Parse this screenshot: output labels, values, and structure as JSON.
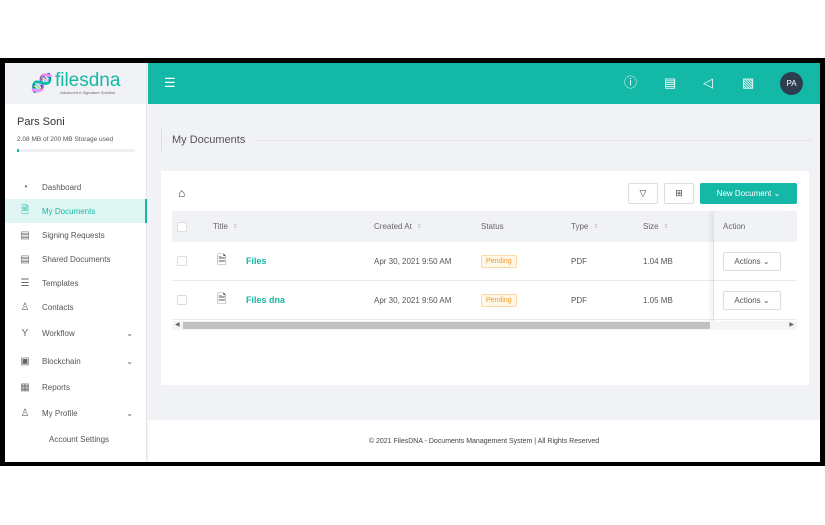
{
  "brand": {
    "name": "filesdna",
    "tagline": "Advanced e-Signature Solution"
  },
  "user": {
    "name": "Pars Soni",
    "storage": "2.08 MB of 200 MB Storage used",
    "storage_used_pct": 1.04,
    "avatar_initials": "PA"
  },
  "sidebar": {
    "items": [
      {
        "label": "Dashboard",
        "icon": "dashboard-icon"
      },
      {
        "label": "My Documents",
        "icon": "document-icon",
        "active": true
      },
      {
        "label": "Signing Requests",
        "icon": "signing-icon"
      },
      {
        "label": "Shared Documents",
        "icon": "shared-icon"
      },
      {
        "label": "Templates",
        "icon": "template-icon"
      },
      {
        "label": "Contacts",
        "icon": "contacts-icon"
      },
      {
        "label": "Workflow",
        "icon": "workflow-icon",
        "expandable": true
      },
      {
        "label": "Blockchain",
        "icon": "blockchain-icon",
        "expandable": true
      },
      {
        "label": "Reports",
        "icon": "reports-icon"
      },
      {
        "label": "My Profile",
        "icon": "user-icon",
        "expandable": true
      }
    ],
    "subitems": [
      "Account Settings"
    ]
  },
  "page": {
    "title": "My Documents"
  },
  "toolbar": {
    "new_document": "New Document"
  },
  "table": {
    "headers": {
      "title": "Title",
      "created": "Created At",
      "status": "Status",
      "type": "Type",
      "size": "Size",
      "action": "Action"
    },
    "rows": [
      {
        "title": "Files",
        "created": "Apr 30, 2021 9:50 AM",
        "status": "Pending",
        "type": "PDF",
        "size": "1.04 MB",
        "action": "Actions"
      },
      {
        "title": "Files dna",
        "created": "Apr 30, 2021 9:50 AM",
        "status": "Pending",
        "type": "PDF",
        "size": "1.05 MB",
        "action": "Actions"
      }
    ]
  },
  "footer": {
    "text": "© 2021 FilesDNA - Documents Management System | All Rights Reserved"
  },
  "colors": {
    "accent": "#14b8a6",
    "avatar": "#2d3e50",
    "pending": "#f59a23"
  }
}
